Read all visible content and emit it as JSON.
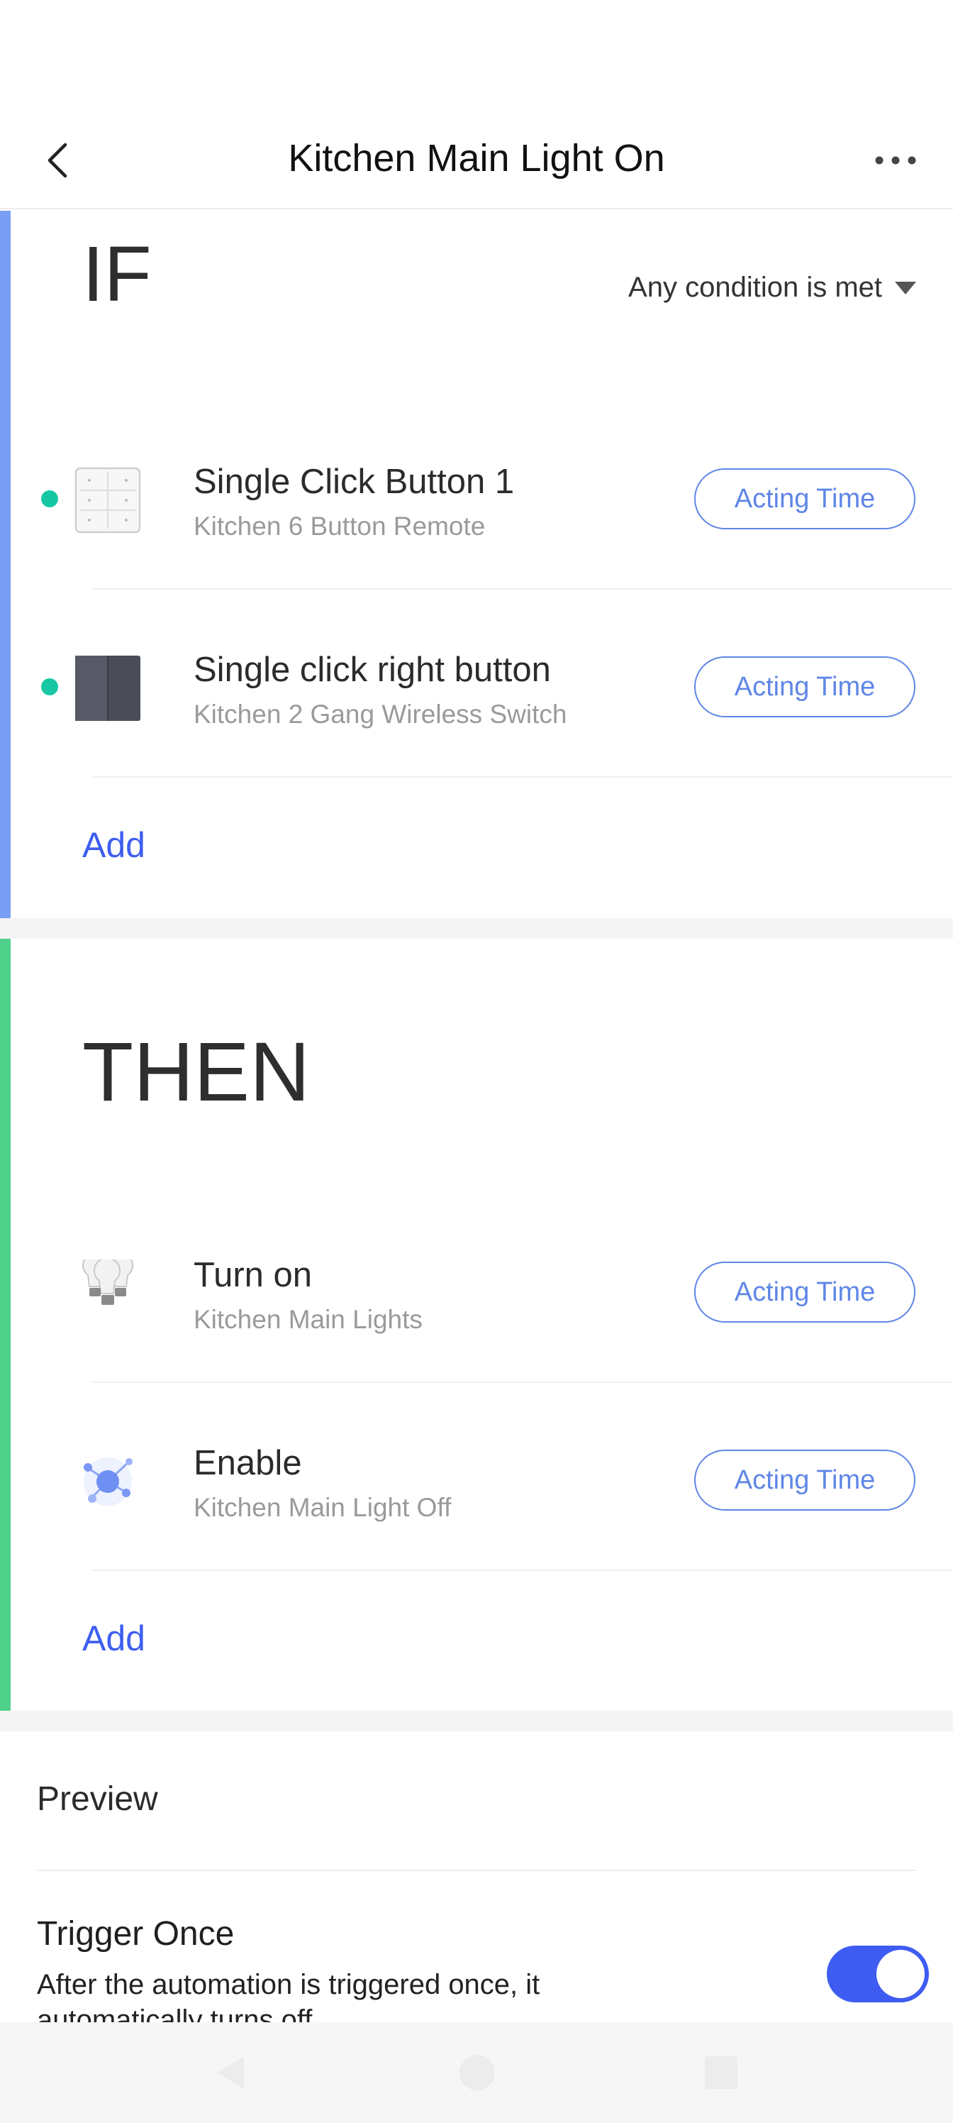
{
  "header": {
    "title": "Kitchen Main Light On",
    "back_icon": "chevron-left-icon",
    "more_icon": "more-horizontal-icon"
  },
  "if_section": {
    "heading": "IF",
    "condition_mode": "Any condition is met",
    "accent_color": "#7a9ef5",
    "conditions": [
      {
        "title": "Single Click Button 1",
        "subtitle": "Kitchen 6 Button Remote",
        "icon": "six-button-remote-icon",
        "action_label": "Acting Time"
      },
      {
        "title": "Single click right button",
        "subtitle": "Kitchen 2 Gang Wireless Switch",
        "icon": "two-gang-switch-icon",
        "action_label": "Acting Time"
      }
    ],
    "add_label": "Add"
  },
  "then_section": {
    "heading": "THEN",
    "accent_color": "#4fd08a",
    "actions": [
      {
        "title": "Turn on",
        "subtitle": "Kitchen Main Lights",
        "icon": "light-bulbs-icon",
        "action_label": "Acting Time"
      },
      {
        "title": "Enable",
        "subtitle": "Kitchen Main Light Off",
        "icon": "automation-icon",
        "action_label": "Acting Time"
      }
    ],
    "add_label": "Add"
  },
  "settings": {
    "preview_label": "Preview",
    "trigger_once": {
      "title": "Trigger Once",
      "description": "After the automation is triggered once, it automatically turns off",
      "enabled": true
    }
  },
  "colors": {
    "link": "#3d5ef0",
    "button_outline": "#5f86e6",
    "status_dot": "#17c7a3",
    "toggle_on": "#3f5cf2"
  }
}
